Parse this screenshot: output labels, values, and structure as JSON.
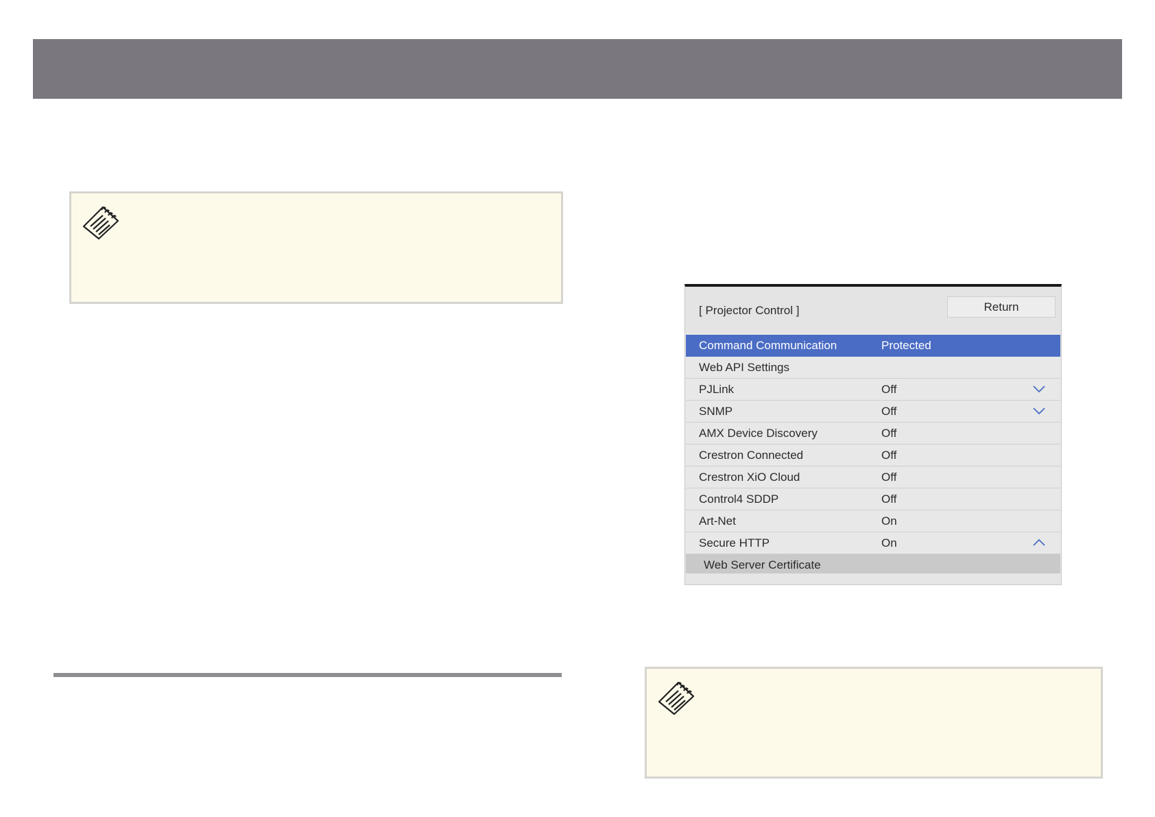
{
  "menu": {
    "title": "[ Projector Control ]",
    "return_label": "Return",
    "rows": [
      {
        "label": "Command Communication",
        "value": "Protected"
      },
      {
        "label": "Web API Settings",
        "value": ""
      },
      {
        "label": "PJLink",
        "value": "Off"
      },
      {
        "label": "SNMP",
        "value": "Off"
      },
      {
        "label": "AMX Device Discovery",
        "value": "Off"
      },
      {
        "label": "Crestron Connected",
        "value": "Off"
      },
      {
        "label": "Crestron XiO Cloud",
        "value": "Off"
      },
      {
        "label": "Control4 SDDP",
        "value": "Off"
      },
      {
        "label": "Art-Net",
        "value": "On"
      },
      {
        "label": "Secure HTTP",
        "value": "On"
      },
      {
        "label": "Web Server Certificate",
        "value": ""
      }
    ],
    "selected_row": "Command Communication"
  },
  "icons": {
    "note": "note-pad-icon",
    "expand": "chevron-down-icon",
    "collapse": "chevron-up-icon"
  },
  "colors": {
    "header_bar": "#7a777e",
    "note_background": "#fdfaea",
    "selected_row": "#4a6cc4"
  }
}
